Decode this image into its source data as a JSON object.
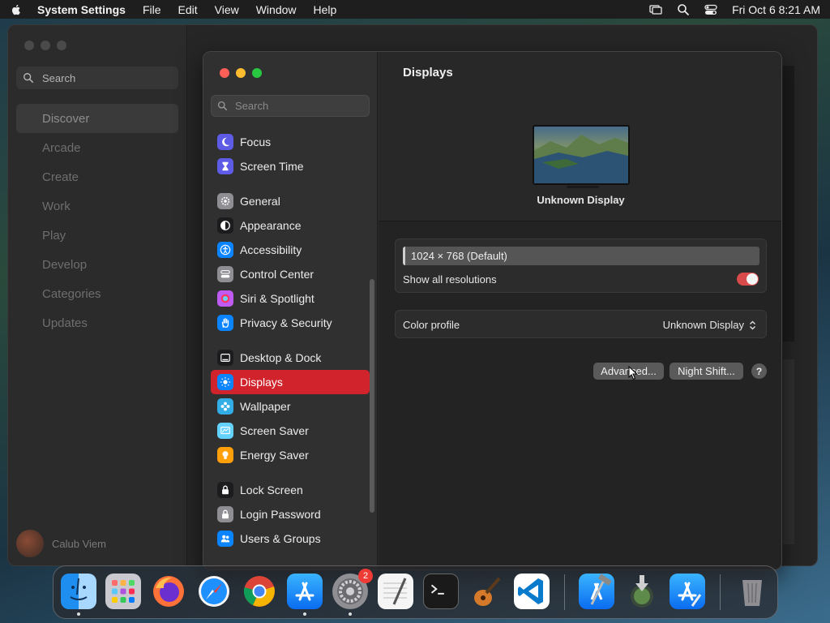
{
  "menubar": {
    "app_name": "System Settings",
    "menus": [
      "File",
      "Edit",
      "View",
      "Window",
      "Help"
    ],
    "clock": "Fri Oct 6  8:21 AM"
  },
  "appstore": {
    "search_placeholder": "Search",
    "nav": [
      "Discover",
      "Arcade",
      "Create",
      "Work",
      "Play",
      "Develop",
      "Categories",
      "Updates"
    ],
    "active_nav": "Discover",
    "user_name": "Calub Viem"
  },
  "settings": {
    "search_placeholder": "Search",
    "sidebar": [
      {
        "label": "Focus",
        "icon": "moon-icon",
        "color": "#5e5ce6"
      },
      {
        "label": "Screen Time",
        "icon": "hourglass-icon",
        "color": "#5e5ce6"
      },
      {
        "gap": true
      },
      {
        "label": "General",
        "icon": "gear-icon",
        "color": "#8e8e93"
      },
      {
        "label": "Appearance",
        "icon": "appearance-icon",
        "color": "#1c1c1e"
      },
      {
        "label": "Accessibility",
        "icon": "accessibility-icon",
        "color": "#0a84ff"
      },
      {
        "label": "Control Center",
        "icon": "control-center-icon",
        "color": "#8e8e93"
      },
      {
        "label": "Siri & Spotlight",
        "icon": "siri-icon",
        "color": "#bf5af2"
      },
      {
        "label": "Privacy & Security",
        "icon": "hand-icon",
        "color": "#0a84ff"
      },
      {
        "gap": true
      },
      {
        "label": "Desktop & Dock",
        "icon": "dock-icon",
        "color": "#1c1c1e"
      },
      {
        "label": "Displays",
        "icon": "sun-icon",
        "color": "#0a84ff",
        "active": true
      },
      {
        "label": "Wallpaper",
        "icon": "flower-icon",
        "color": "#32ade6"
      },
      {
        "label": "Screen Saver",
        "icon": "screensaver-icon",
        "color": "#64d2ff"
      },
      {
        "label": "Energy Saver",
        "icon": "bulb-icon",
        "color": "#ff9f0a"
      },
      {
        "gap": true
      },
      {
        "label": "Lock Screen",
        "icon": "lock-icon",
        "color": "#1c1c1e"
      },
      {
        "label": "Login Password",
        "icon": "login-lock-icon",
        "color": "#8e8e93"
      },
      {
        "label": "Users & Groups",
        "icon": "users-icon",
        "color": "#0a84ff"
      }
    ],
    "main": {
      "title": "Displays",
      "display_name": "Unknown Display",
      "resolution": "1024 × 768 (Default)",
      "show_all_label": "Show all resolutions",
      "show_all_on": true,
      "color_profile_label": "Color profile",
      "color_profile_value": "Unknown Display",
      "advanced_label": "Advanced...",
      "night_shift_label": "Night Shift...",
      "help_label": "?"
    }
  },
  "dock": {
    "settings_badge": "2"
  }
}
